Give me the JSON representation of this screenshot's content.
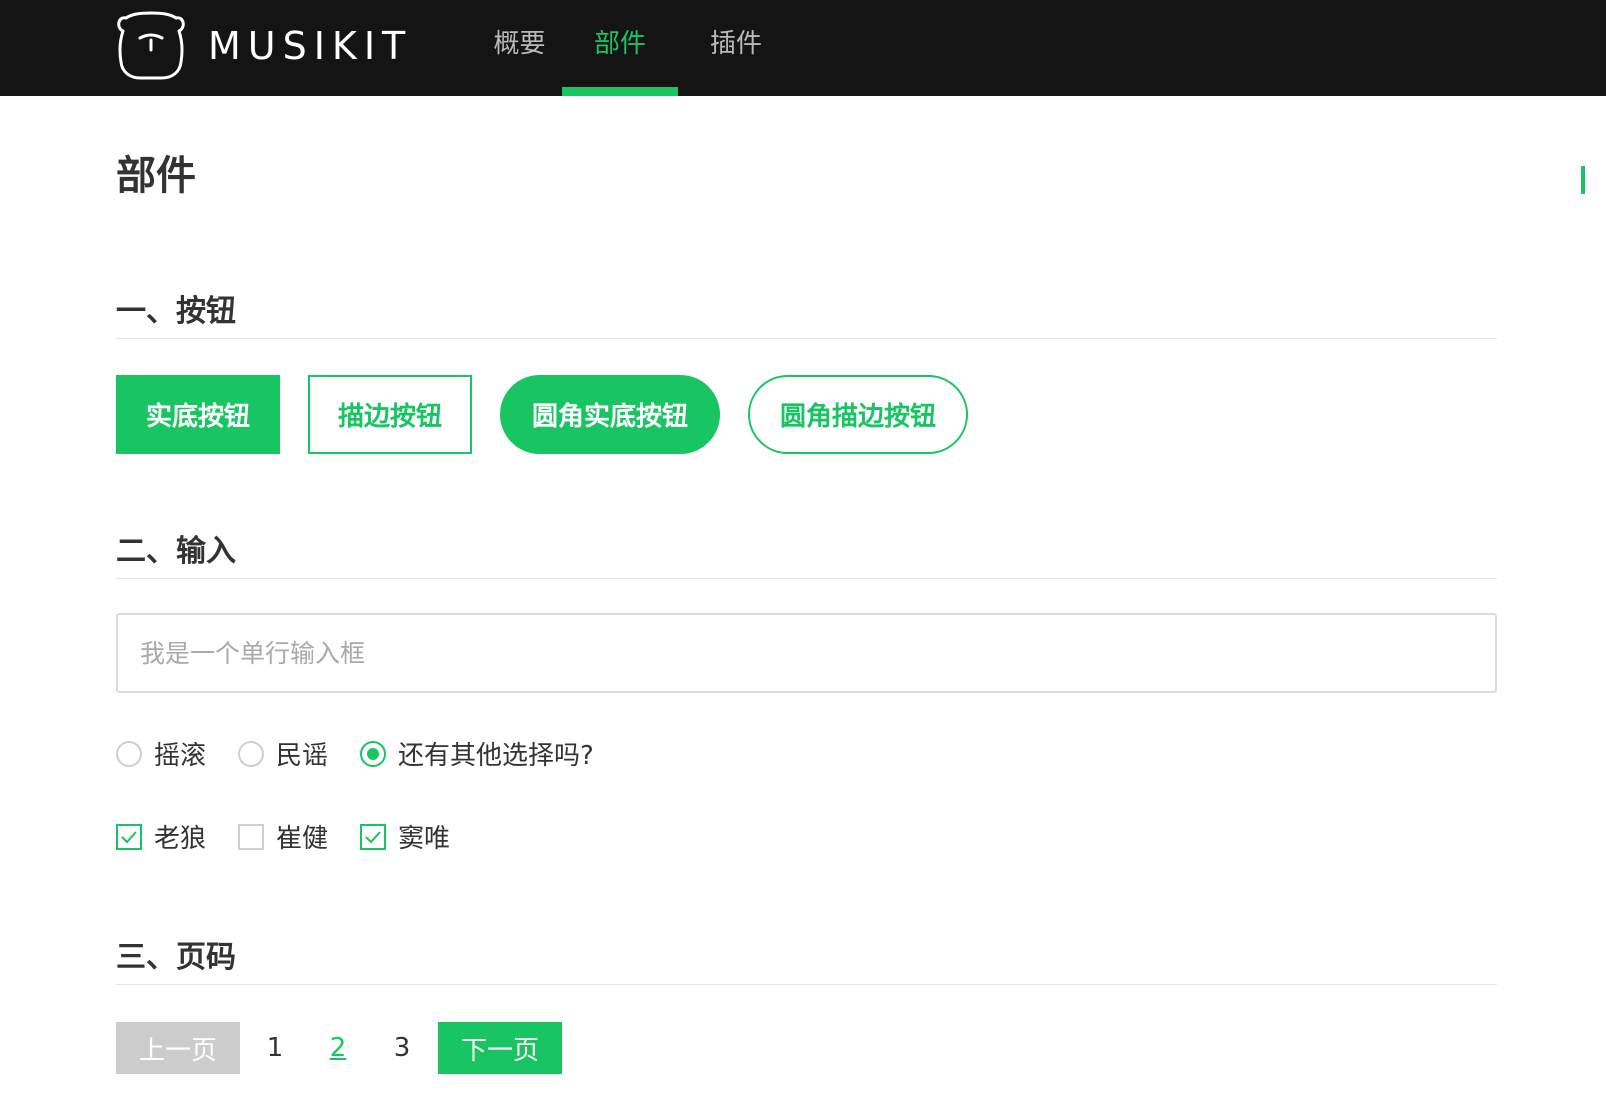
{
  "app": {
    "logo_text": "MUSIKIT",
    "accent_color": "#19c463",
    "nav": [
      {
        "label": "概要",
        "active": false
      },
      {
        "label": "部件",
        "active": true
      },
      {
        "label": "插件",
        "active": false
      }
    ]
  },
  "page": {
    "title": "部件"
  },
  "sections": {
    "buttons": {
      "title": "一、按钮",
      "items": [
        "实底按钮",
        "描边按钮",
        "圆角实底按钮",
        "圆角描边按钮"
      ]
    },
    "inputs": {
      "title": "二、输入",
      "text_placeholder": "我是一个单行输入框",
      "text_value": "",
      "radios": [
        {
          "label": "摇滚",
          "checked": false
        },
        {
          "label": "民谣",
          "checked": false
        },
        {
          "label": "还有其他选择吗?",
          "checked": true
        }
      ],
      "checkboxes": [
        {
          "label": "老狼",
          "checked": true
        },
        {
          "label": "崔健",
          "checked": false
        },
        {
          "label": "窦唯",
          "checked": true
        }
      ]
    },
    "pagination": {
      "title": "三、页码",
      "prev_label": "上一页",
      "next_label": "下一页",
      "pages": [
        "1",
        "2",
        "3"
      ],
      "current_page": "2"
    }
  },
  "icons": {
    "logo": "bear-logo-icon",
    "radio_checked": "radio-dot-icon",
    "checkbox_checked": "checkmark-icon"
  }
}
